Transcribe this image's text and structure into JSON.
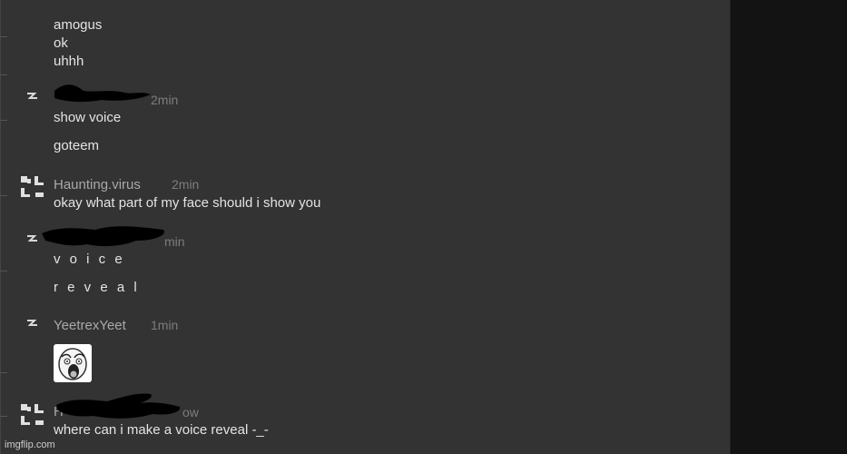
{
  "messages_top": {
    "line1": "amogus",
    "line2": "ok",
    "line3": "uhhh"
  },
  "group1": {
    "username": "",
    "time": "2min",
    "messages": [
      "show voice",
      "goteem"
    ]
  },
  "group2": {
    "username": "Haunting.virus",
    "time": "2min",
    "messages": [
      "okay what part of my face should i show you"
    ]
  },
  "group3": {
    "username": "",
    "time": "min",
    "messages": [
      "v o i c e",
      "r e v e a l"
    ]
  },
  "group4": {
    "username": "YeetrexYeet",
    "time": "1min",
    "attachment_icon": "meme-face-icon"
  },
  "group5": {
    "username": "H",
    "time": "ow",
    "messages": [
      "where can i make a voice reveal -_-"
    ]
  },
  "watermark": "imgflip.com",
  "colors": {
    "chat_background": "#333333",
    "side_background": "#131313",
    "message_text": "#e4e4e4",
    "username_text": "#a9a9a9",
    "timestamp_text": "#7d7d7d"
  }
}
